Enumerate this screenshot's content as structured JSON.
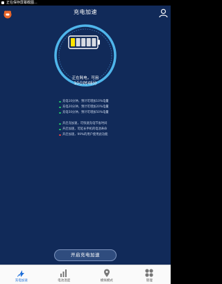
{
  "statusbar": {
    "text": "正在保存屏幕截图..."
  },
  "header": {
    "title": "充电加速"
  },
  "battery": {
    "level_fraction": 0.2,
    "status_line1": "正在耗电，可用",
    "status_line2": "10小时48分",
    "accent_color": "#ffe400",
    "ring_color": "#4fb5ea"
  },
  "notes": {
    "charge_tips": [
      {
        "text": "充电10分钟，预计可增加10%电量",
        "color": "#22c76a"
      },
      {
        "text": "充电20分钟，预计可增加20%电量",
        "color": "#22c76a"
      },
      {
        "text": "充电50分钟，预计可增加50%电量",
        "color": "#22c76a"
      }
    ],
    "accel_tips": [
      {
        "text": "开启充加速，可快速充电节省时间",
        "color": "#22c76a"
      },
      {
        "text": "开启加速，可延长手机的电池寿命",
        "color": "#22c76a"
      },
      {
        "text": "开启加速，99%的用户使用此功能",
        "color": "#e84545"
      }
    ]
  },
  "cta": {
    "label": "开启充电加速"
  },
  "tabbar": {
    "tabs": [
      {
        "label": "充电加速",
        "icon": "charge-icon",
        "active": true
      },
      {
        "label": "电池温度",
        "icon": "bar-chart-icon",
        "active": false
      },
      {
        "label": "模拟模式",
        "icon": "location-pin-icon",
        "active": false
      },
      {
        "label": "管理",
        "icon": "grid-icon",
        "active": false
      }
    ]
  }
}
